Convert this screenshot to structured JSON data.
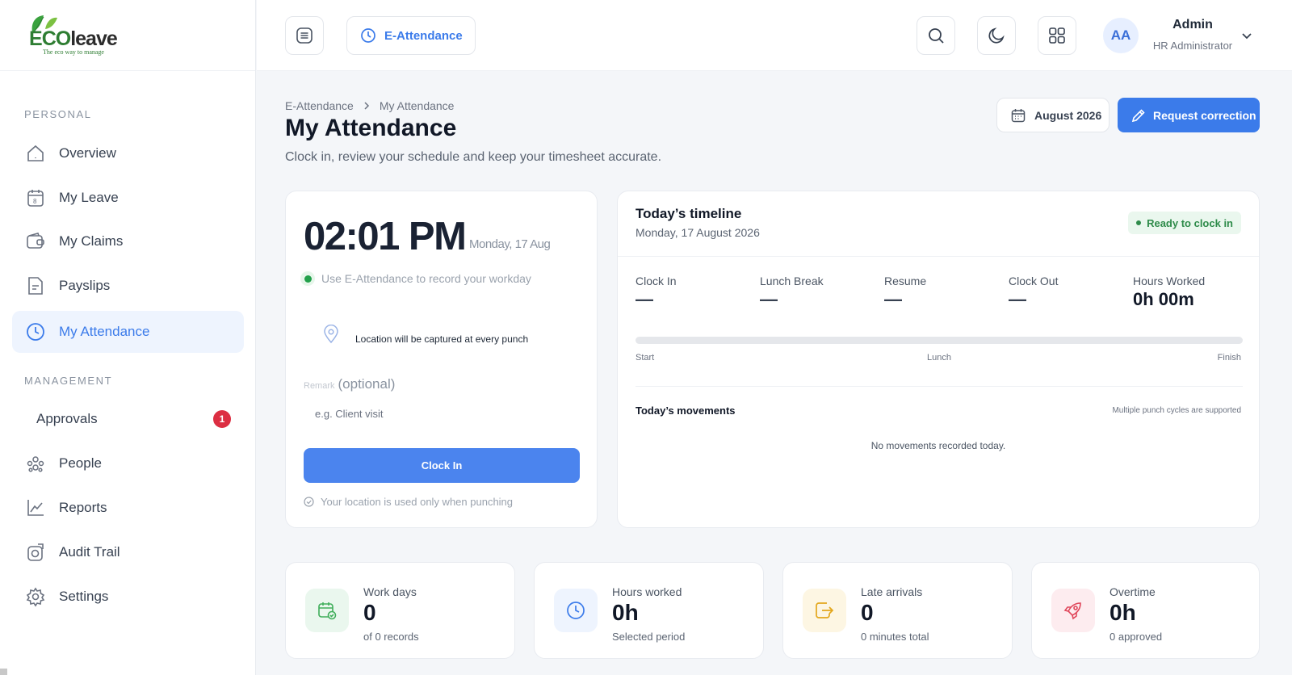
{
  "brand": {
    "name": "ECOleave",
    "tagline": "The eco way to manage",
    "color": "#2e7d32"
  },
  "sidebar": {
    "personal_label": "PERSONAL",
    "management_label": "MANAGEMENT",
    "personal_items": [
      {
        "label": "Overview",
        "icon": "home-icon"
      },
      {
        "label": "My Leave",
        "icon": "calendar-icon"
      },
      {
        "label": "My Claims",
        "icon": "wallet-icon"
      },
      {
        "label": "Payslips",
        "icon": "document-icon"
      },
      {
        "label": "My Attendance",
        "icon": "clock-icon",
        "active": true
      }
    ],
    "management_items": [
      {
        "label": "Approvals",
        "badge": "1"
      },
      {
        "label": "People",
        "icon": "people-icon"
      },
      {
        "label": "Reports",
        "icon": "chart-icon"
      },
      {
        "label": "Audit Trail",
        "icon": "audit-icon"
      },
      {
        "label": "Settings",
        "icon": "gear-icon"
      }
    ]
  },
  "header": {
    "module": "E-Attendance",
    "user": {
      "initials": "AA",
      "name": "Admin",
      "role": "HR Administrator"
    }
  },
  "page": {
    "breadcrumb": [
      "E-Attendance",
      "My Attendance"
    ],
    "title": "My Attendance",
    "subtitle": "Clock in, review your schedule and keep your timesheet accurate.",
    "month": "August 2026",
    "request_label": "Request correction"
  },
  "clock_card": {
    "time": "02:01 PM",
    "date": "Monday, 17 Aug",
    "hint": "Use E-Attendance to record your workday",
    "location": "Location will be captured at every punch",
    "remark_small": "Remark",
    "remark_label": "(optional)",
    "remark_placeholder": "e.g. Client visit",
    "clock_in_label": "Clock In",
    "note": "Your location is used only when punching"
  },
  "timeline": {
    "title": "Today’s timeline",
    "date": "Monday, 17 August 2026",
    "status": "Ready to clock in",
    "columns": [
      {
        "label": "Clock In",
        "value": "—"
      },
      {
        "label": "Lunch Break",
        "value": "—"
      },
      {
        "label": "Resume",
        "value": "—"
      },
      {
        "label": "Clock Out",
        "value": "—"
      },
      {
        "label": "Hours Worked",
        "value": "0h 00m"
      }
    ],
    "progress": 0,
    "bar_labels": {
      "start": "Start",
      "mid": "Lunch",
      "end": "Finish"
    },
    "movements_title": "Today’s movements",
    "movements_note": "Multiple punch cycles are supported",
    "movements_empty": "No movements recorded today."
  },
  "stats": [
    {
      "label": "Work days",
      "value": "0",
      "sub": "of 0 records",
      "icon": "calendar-check-icon",
      "color": "#3fae5a",
      "bg": "#eaf7ee"
    },
    {
      "label": "Hours worked",
      "value": "0h",
      "sub": "Selected period",
      "icon": "clock-icon",
      "color": "#3b7bea",
      "bg": "#eef4fe"
    },
    {
      "label": "Late arrivals",
      "value": "0",
      "sub": "0 minutes total",
      "icon": "login-icon",
      "color": "#e3a71c",
      "bg": "#fdf6e3"
    },
    {
      "label": "Overtime",
      "value": "0h",
      "sub": "0 approved",
      "icon": "rocket-icon",
      "color": "#e0465a",
      "bg": "#fdecef"
    }
  ],
  "colors": {
    "accent": "#3b7bea",
    "success": "#22a04a",
    "danger": "#dc2e42"
  }
}
